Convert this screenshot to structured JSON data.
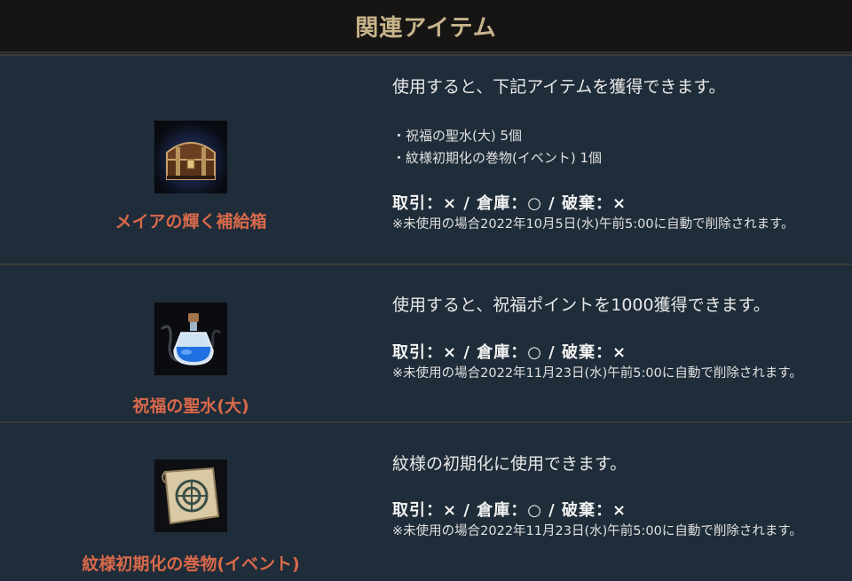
{
  "header": {
    "title": "関連アイテム"
  },
  "items": [
    {
      "name": "メイアの輝く補給箱",
      "icon": "treasure-chest-icon",
      "description": "使用すると、下記アイテムを獲得できます。",
      "bullets": [
        "・祝福の聖水(大) 5個",
        "・紋様初期化の巻物(イベント) 1個"
      ],
      "trade": "取引：× / 倉庫：○ / 破棄：×",
      "note": "※未使用の場合2022年10月5日(水)午前5:00に自動で削除されます。"
    },
    {
      "name": "祝福の聖水(大)",
      "icon": "holy-water-bottle-icon",
      "description": "使用すると、祝福ポイントを1000獲得できます。",
      "bullets": [],
      "trade": "取引：× / 倉庫：○ / 破棄：×",
      "note": "※未使用の場合2022年11月23日(水)午前5:00に自動で削除されます。"
    },
    {
      "name": "紋様初期化の巻物(イベント)",
      "icon": "scroll-icon",
      "description": "紋様の初期化に使用できます。",
      "bullets": [],
      "trade": "取引：× / 倉庫：○ / 破棄：×",
      "note": "※未使用の場合2022年11月23日(水)午前5:00に自動で削除されます。"
    }
  ],
  "colors": {
    "header_text": "#c8b48a",
    "item_name": "#d8694a",
    "row_background": "#1f2c39",
    "header_background": "#161514"
  }
}
